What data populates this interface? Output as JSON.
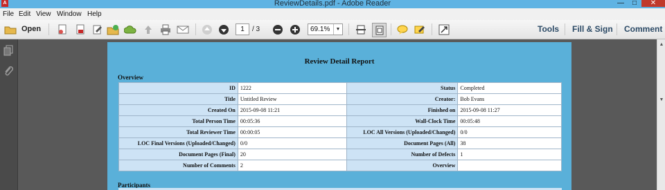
{
  "window": {
    "title": "ReviewDetails.pdf - Adobe Reader",
    "icon_name": "adobe-reader-icon",
    "controls": {
      "minimize": "—",
      "maximize": "□",
      "close": "✕"
    }
  },
  "menu": {
    "items": [
      "File",
      "Edit",
      "View",
      "Window",
      "Help"
    ]
  },
  "toolbar": {
    "open_label": "Open",
    "page_current": "1",
    "page_total": "/ 3",
    "zoom": "69.1%",
    "icons": [
      "open-folder-icon",
      "create-pdf-icon",
      "pdf-icon",
      "edit-icon",
      "share-icon",
      "upload-icon",
      "save-icon",
      "print-icon",
      "email-icon",
      "previous-page-icon",
      "next-page-icon",
      "zoom-out-icon",
      "zoom-in-icon",
      "fit-width-icon",
      "fit-page-icon",
      "comment-icon",
      "highlight-icon",
      "fullscreen-icon"
    ]
  },
  "panes": {
    "tools": "Tools",
    "fill_sign": "Fill & Sign",
    "comment": "Comment"
  },
  "document": {
    "title": "Review Detail Report",
    "overview_heading": "Overview",
    "participants_heading": "Participants",
    "rows": [
      {
        "l1": "ID",
        "v1": "1222",
        "l2": "Status",
        "v2": "Completed"
      },
      {
        "l1": "Title",
        "v1": "Untitled Review",
        "l2": "Creator:",
        "v2": "Bob Evans"
      },
      {
        "l1": "Created On",
        "v1": "2015-09-08 11:21",
        "l2": "Finished on",
        "v2": "2015-09-08 11:27"
      },
      {
        "l1": "Total Person Time",
        "v1": "00:05:36",
        "l2": "Wall-Clock Time",
        "v2": "00:05:48"
      },
      {
        "l1": "Total Reviewer Time",
        "v1": "00:00:05",
        "l2": "LOC All Versions (Uploaded/Changed)",
        "v2": "0/0"
      },
      {
        "l1": "LOC Final Versions (Uploaded/Changed)",
        "v1": "0/0",
        "l2": "Document Pages (All)",
        "v2": "38"
      },
      {
        "l1": "Document Pages (Final)",
        "v1": "20",
        "l2": "Number of Defects",
        "v2": "1"
      },
      {
        "l1": "Number of Comments",
        "v1": "2",
        "l2": "Overview",
        "v2": ""
      }
    ]
  },
  "colors": {
    "title_bar": "#5fb3e3",
    "page_bg": "#5ab0d9",
    "label_cell": "#cde3f5",
    "close_button": "#c0392b"
  }
}
